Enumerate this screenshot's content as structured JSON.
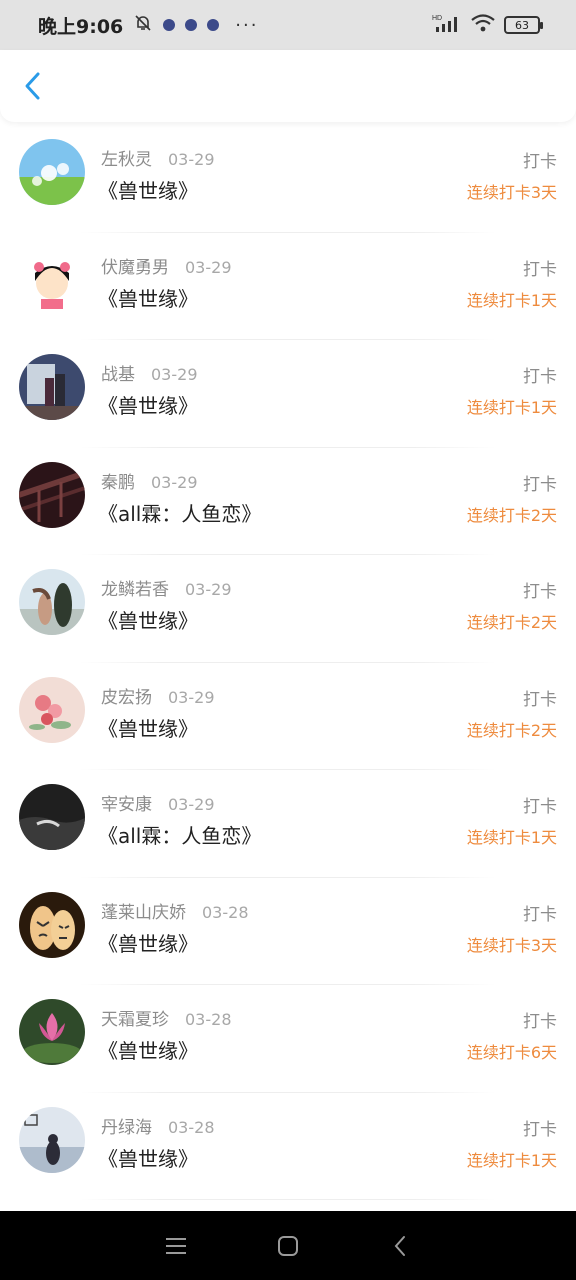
{
  "status_bar": {
    "time": "晚上9:06",
    "more": "···",
    "network": "HD",
    "battery": "63"
  },
  "nav": {
    "back_icon": "chevron-left-icon",
    "accent": "#2a9be8"
  },
  "colors": {
    "streak": "#ee8b3e",
    "name": "#8c8c8c",
    "book": "#222222"
  },
  "records": [
    {
      "name": "左秋灵",
      "date": "03-29",
      "book": "《兽世缘》",
      "action": "打卡",
      "streak": "连续打卡3天",
      "avatar": "dandelion-avatar"
    },
    {
      "name": "伏魔勇男",
      "date": "03-29",
      "book": "《兽世缘》",
      "action": "打卡",
      "streak": "连续打卡1天",
      "avatar": "cartoon-girl-avatar"
    },
    {
      "name": "战基",
      "date": "03-29",
      "book": "《兽世缘》",
      "action": "打卡",
      "streak": "连续打卡1天",
      "avatar": "couple-photo-avatar"
    },
    {
      "name": "秦鹏",
      "date": "03-29",
      "book": "《all霖：人鱼恋》",
      "action": "打卡",
      "streak": "连续打卡2天",
      "avatar": "railing-photo-avatar"
    },
    {
      "name": "龙鳞若香",
      "date": "03-29",
      "book": "《兽世缘》",
      "action": "打卡",
      "streak": "连续打卡2天",
      "avatar": "dancing-couple-avatar"
    },
    {
      "name": "皮宏扬",
      "date": "03-29",
      "book": "《兽世缘》",
      "action": "打卡",
      "streak": "连续打卡2天",
      "avatar": "flowers-avatar"
    },
    {
      "name": "宰安康",
      "date": "03-29",
      "book": "《all霖：人鱼恋》",
      "action": "打卡",
      "streak": "连续打卡1天",
      "avatar": "ocean-wave-avatar"
    },
    {
      "name": "蓬莱山庆娇",
      "date": "03-28",
      "book": "《兽世缘》",
      "action": "打卡",
      "streak": "连续打卡3天",
      "avatar": "finger-faces-avatar"
    },
    {
      "name": "天霜夏珍",
      "date": "03-28",
      "book": "《兽世缘》",
      "action": "打卡",
      "streak": "连续打卡6天",
      "avatar": "lotus-avatar"
    },
    {
      "name": "丹绿海",
      "date": "03-28",
      "book": "《兽世缘》",
      "action": "打卡",
      "streak": "连续打卡1天",
      "avatar": "seaside-girl-avatar"
    }
  ],
  "system_nav": {
    "menu_icon": "menu-icon",
    "home_icon": "home-icon",
    "back_icon": "back-icon"
  }
}
